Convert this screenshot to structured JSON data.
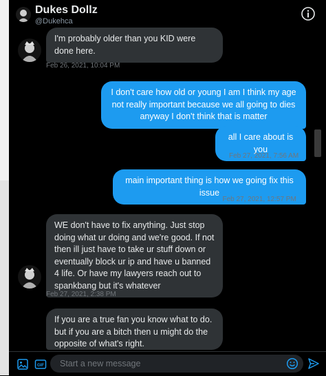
{
  "header": {
    "name": "Dukes Dollz",
    "handle": "@Dukehca"
  },
  "messages": [
    {
      "text": "I'm probably older than you KID were done here.",
      "timestamp": "Feb 26, 2021, 10:04 PM"
    },
    {
      "text": "I don't care how old or young I am I think my age not really important because we all going to dies anyway I don't think that is matter"
    },
    {
      "text": "all I care about is you",
      "timestamp": "Feb 27, 2021, 7:56 AM"
    },
    {
      "text": "main important thing is how we going fix this issue",
      "timestamp": "Feb 27, 2021, 12:57 PM"
    },
    {
      "text": "WE don't have to fix anything. Just stop doing what ur doing and we're good. If not then ill just have to take ur stuff down or eventually block ur ip and have u banned 4 life. Or have my lawyers reach out to spankbang but it's whatever",
      "timestamp": "Feb 27, 2021, 2:38 PM"
    },
    {
      "text": "If you are a true fan you know what to do. but if you are a bitch then u might do the opposite of what's right."
    }
  ],
  "composer": {
    "placeholder": "Start a new message"
  },
  "icons": {
    "read_receipt": "checkmark-icon",
    "info": "info-icon",
    "media": "image-icon",
    "gif": "gif-icon",
    "emoji": "emoji-icon",
    "send": "send-icon"
  },
  "colors": {
    "accent": "#1d9bf0",
    "incoming_bubble": "#2f3336",
    "background": "#000000"
  }
}
